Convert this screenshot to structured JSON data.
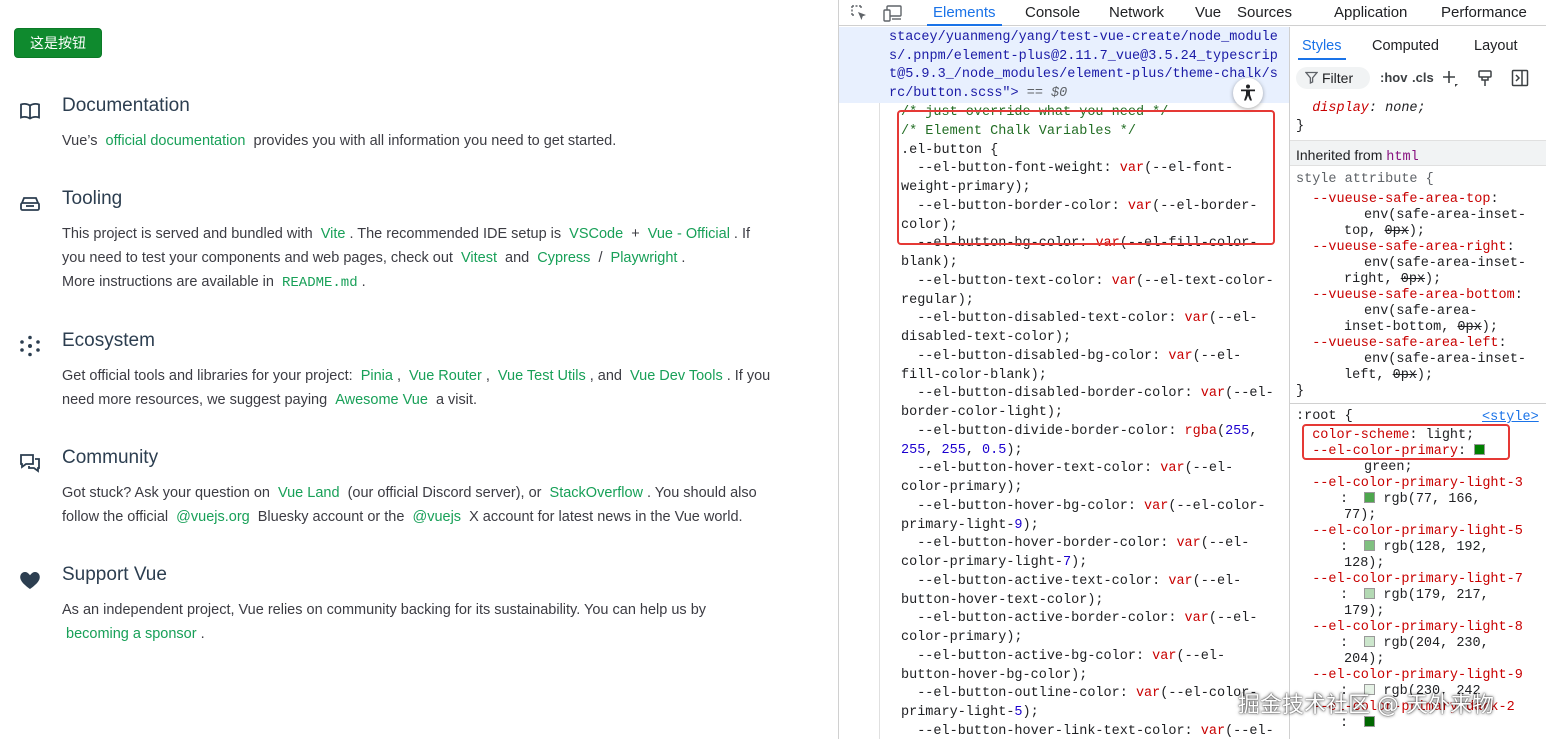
{
  "app": {
    "button_label": "这是按钮",
    "sections": [
      {
        "icon": "book-icon",
        "title": "Documentation",
        "lines": [
          [
            [
              "t",
              "Vue’s "
            ],
            [
              "a",
              "official documentation"
            ],
            [
              "t",
              " provides you with all information you need to get started."
            ]
          ]
        ]
      },
      {
        "icon": "toolbox-icon",
        "title": "Tooling",
        "lines": [
          [
            [
              "t",
              "This project is served and bundled with "
            ],
            [
              "a",
              "Vite"
            ],
            [
              "t",
              ". The recommended IDE setup is "
            ],
            [
              "a",
              "VSCode"
            ],
            [
              "t",
              " + "
            ],
            [
              "a",
              "Vue - Official"
            ],
            [
              "t",
              ". If"
            ]
          ],
          [
            [
              "t",
              "you need to test your components and web pages, check out "
            ],
            [
              "a",
              "Vitest"
            ],
            [
              "t",
              " and "
            ],
            [
              "a",
              "Cypress"
            ],
            [
              "t",
              " / "
            ],
            [
              "a",
              "Playwright"
            ],
            [
              "t",
              "."
            ]
          ],
          [
            [
              "t",
              "More instructions are available in "
            ],
            [
              "c",
              "README.md"
            ],
            [
              "t",
              "."
            ]
          ]
        ]
      },
      {
        "icon": "ecosystem-icon",
        "title": "Ecosystem",
        "lines": [
          [
            [
              "t",
              "Get official tools and libraries for your project: "
            ],
            [
              "a",
              "Pinia"
            ],
            [
              "t",
              ", "
            ],
            [
              "a",
              "Vue Router"
            ],
            [
              "t",
              ", "
            ],
            [
              "a",
              "Vue Test Utils"
            ],
            [
              "t",
              ", and "
            ],
            [
              "a",
              "Vue Dev Tools"
            ],
            [
              "t",
              ". If you"
            ]
          ],
          [
            [
              "t",
              "need more resources, we suggest paying "
            ],
            [
              "a",
              "Awesome Vue"
            ],
            [
              "t",
              " a visit."
            ]
          ]
        ]
      },
      {
        "icon": "community-icon",
        "title": "Community",
        "lines": [
          [
            [
              "t",
              "Got stuck? Ask your question on "
            ],
            [
              "a",
              "Vue Land"
            ],
            [
              "t",
              " (our official Discord server), or "
            ],
            [
              "a",
              "StackOverflow"
            ],
            [
              "t",
              ". You should also"
            ]
          ],
          [
            [
              "t",
              "follow the official "
            ],
            [
              "a",
              "@vuejs.org"
            ],
            [
              "t",
              " Bluesky account or the "
            ],
            [
              "a",
              "@vuejs"
            ],
            [
              "t",
              " X account for latest news in the Vue world."
            ]
          ]
        ]
      },
      {
        "icon": "heart-icon",
        "title": "Support Vue",
        "lines": [
          [
            [
              "t",
              "As an independent project, Vue relies on community backing for its sustainability. You can help us by"
            ]
          ],
          [
            [
              "a",
              "becoming a sponsor"
            ],
            [
              "t",
              "."
            ]
          ]
        ]
      }
    ]
  },
  "devtools": {
    "tabs": [
      "Elements",
      "Console",
      "Network",
      "Vue",
      "Sources",
      "Application",
      "Performance"
    ],
    "active_tab": "Elements",
    "selected_node_lines": [
      "stacey/yuanmeng/yang/test-vue-create/node_module",
      "s/.pnpm/element-plus@2.11.7_vue@3.5.24_typescrip",
      "t@5.9.3_/node_modules/element-plus/theme-chalk/s",
      "rc/button.scss\"> == $0"
    ],
    "source_lines": [
      "/* just override what you need */",
      "/* Element Chalk Variables */",
      ".el-button {",
      "  --el-button-font-weight: var(--el-font-",
      "weight-primary);",
      "  --el-button-border-color: var(--el-border-",
      "color);",
      "  --el-button-bg-color: var(--el-fill-color-",
      "blank);",
      "  --el-button-text-color: var(--el-text-color-",
      "regular);",
      "  --el-button-disabled-text-color: var(--el-",
      "disabled-text-color);",
      "  --el-button-disabled-bg-color: var(--el-",
      "fill-color-blank);",
      "  --el-button-disabled-border-color: var(--el-",
      "border-color-light);",
      "  --el-button-divide-border-color: rgba(255,",
      "255, 255, 0.5);",
      "  --el-button-hover-text-color: var(--el-",
      "color-primary);",
      "  --el-button-hover-bg-color: var(--el-color-",
      "primary-light-9);",
      "  --el-button-hover-border-color: var(--el-",
      "color-primary-light-7);",
      "  --el-button-active-text-color: var(--el-",
      "button-hover-text-color);",
      "  --el-button-active-border-color: var(--el-",
      "color-primary);",
      "  --el-button-active-bg-color: var(--el-",
      "button-hover-bg-color);",
      "  --el-button-outline-color: var(--el-color-",
      "primary-light-5);",
      "  --el-button-hover-link-text-color: var(--el-"
    ],
    "styles": {
      "tabs": [
        "Styles",
        "Computed",
        "Layout"
      ],
      "active_tab": "Styles",
      "filter_placeholder": "Filter",
      "hov_label": ":hov",
      "cls_label": ".cls",
      "top_rule": [
        "  display: none;",
        "}"
      ],
      "inherited_label": "Inherited from",
      "inherited_tag": "html",
      "style_attr_header": "style attribute {",
      "vueuse_props": [
        {
          "name": "--vueuse-safe-area-top",
          "value_lines": [
            "env(safe-area-inset-",
            "top, 0px);"
          ]
        },
        {
          "name": "--vueuse-safe-area-right",
          "value_lines": [
            "env(safe-area-inset-",
            "right, 0px);"
          ]
        },
        {
          "name": "--vueuse-safe-area-bottom",
          "value_lines": [
            "env(safe-area-",
            "inset-bottom, 0px);"
          ]
        },
        {
          "name": "--vueuse-safe-area-left",
          "value_lines": [
            "env(safe-area-inset-",
            "left, 0px);"
          ]
        }
      ],
      "root_selector": ":root {",
      "root_source_link": "<style>",
      "root_props": [
        {
          "name": "color-scheme",
          "value": "light;"
        },
        {
          "name": "--el-color-primary",
          "value": "green;",
          "swatch": "#008000"
        },
        {
          "name": "--el-color-primary-light-3",
          "value": "rgb(77, 166, 77);",
          "swatch": "#4da64d"
        },
        {
          "name": "--el-color-primary-light-5",
          "value": "rgb(128, 192, 128);",
          "swatch": "#80c080"
        },
        {
          "name": "--el-color-primary-light-7",
          "value": "rgb(179, 217, 179);",
          "swatch": "#b3d9b3"
        },
        {
          "name": "--el-color-primary-light-8",
          "value": "rgb(204, 230, 204);",
          "swatch": "#cce6cc"
        },
        {
          "name": "--el-color-primary-light-9",
          "value": "rgb(230, 242",
          "swatch": "#e6f2e6"
        },
        {
          "name": "--el-color-primary-dark-2",
          "value": "",
          "swatch": "#006700"
        }
      ]
    }
  },
  "watermark": "掘金技术社区 @ 天外来物",
  "colors": {
    "vue_link": "#18a058",
    "button_green": "#0f8a2e",
    "devtools_accent": "#1a73e8",
    "highlight_box": "#e53935",
    "property_red": "#c80000"
  }
}
